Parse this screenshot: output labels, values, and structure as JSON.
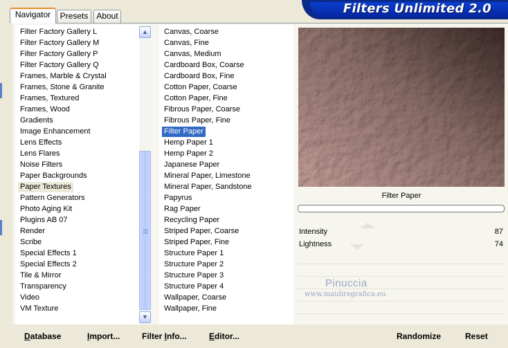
{
  "tabs": [
    {
      "label": "Navigator",
      "active": true
    },
    {
      "label": "Presets",
      "active": false
    },
    {
      "label": "About",
      "active": false
    }
  ],
  "banner": {
    "title": "Filters Unlimited 2.0"
  },
  "categories": {
    "items": [
      "Filter Factory Gallery L",
      "Filter Factory Gallery M",
      "Filter Factory Gallery P",
      "Filter Factory Gallery Q",
      "Frames, Marble & Crystal",
      "Frames, Stone & Granite",
      "Frames, Textured",
      "Frames, Wood",
      "Gradients",
      "Image Enhancement",
      "Lens Effects",
      "Lens Flares",
      "Noise Filters",
      "Paper Backgrounds",
      "Paper Textures",
      "Pattern Generators",
      "Photo Aging Kit",
      "Plugins AB 07",
      "Render",
      "Scribe",
      "Special Effects 1",
      "Special Effects 2",
      "Tile & Mirror",
      "Transparency",
      "Video",
      "VM Texture"
    ],
    "selected": "Paper Textures"
  },
  "filters": {
    "items": [
      "Canvas, Coarse",
      "Canvas, Fine",
      "Canvas, Medium",
      "Cardboard Box, Coarse",
      "Cardboard Box, Fine",
      "Cotton Paper, Coarse",
      "Cotton Paper, Fine",
      "Fibrous Paper, Coarse",
      "Fibrous Paper, Fine",
      "Filter Paper",
      "Hemp Paper 1",
      "Hemp Paper 2",
      "Japanese Paper",
      "Mineral Paper, Limestone",
      "Mineral Paper, Sandstone",
      "Papyrus",
      "Rag Paper",
      "Recycling Paper",
      "Striped Paper, Coarse",
      "Striped Paper, Fine",
      "Structure Paper 1",
      "Structure Paper 2",
      "Structure Paper 3",
      "Structure Paper 4",
      "Wallpaper, Coarse",
      "Wallpaper, Fine"
    ],
    "selected": "Filter Paper"
  },
  "preview": {
    "filter_name": "Filter Paper",
    "colors": {
      "light": "#c49e98",
      "mid": "#8c6e68",
      "dark": "#3a2a28"
    }
  },
  "sliders": [
    {
      "label": "Intensity",
      "value": "87",
      "fraction": 0.34
    },
    {
      "label": "Lightness",
      "value": "74",
      "fraction": 0.29
    }
  ],
  "watermark": {
    "name": "Pinuccia",
    "site": "www.maidiregrafica.eu"
  },
  "buttons": {
    "database": {
      "u": "D",
      "rest": "atabase"
    },
    "import": {
      "u": "I",
      "rest": "mport..."
    },
    "filter_info": {
      "pre": "Filter ",
      "u": "I",
      "rest": "nfo..."
    },
    "editor": {
      "u": "E",
      "rest": "ditor..."
    },
    "randomize": "Randomize",
    "reset": "Reset"
  },
  "colors": {
    "selection": "#316ac5",
    "banner": "#0b3fd0"
  }
}
